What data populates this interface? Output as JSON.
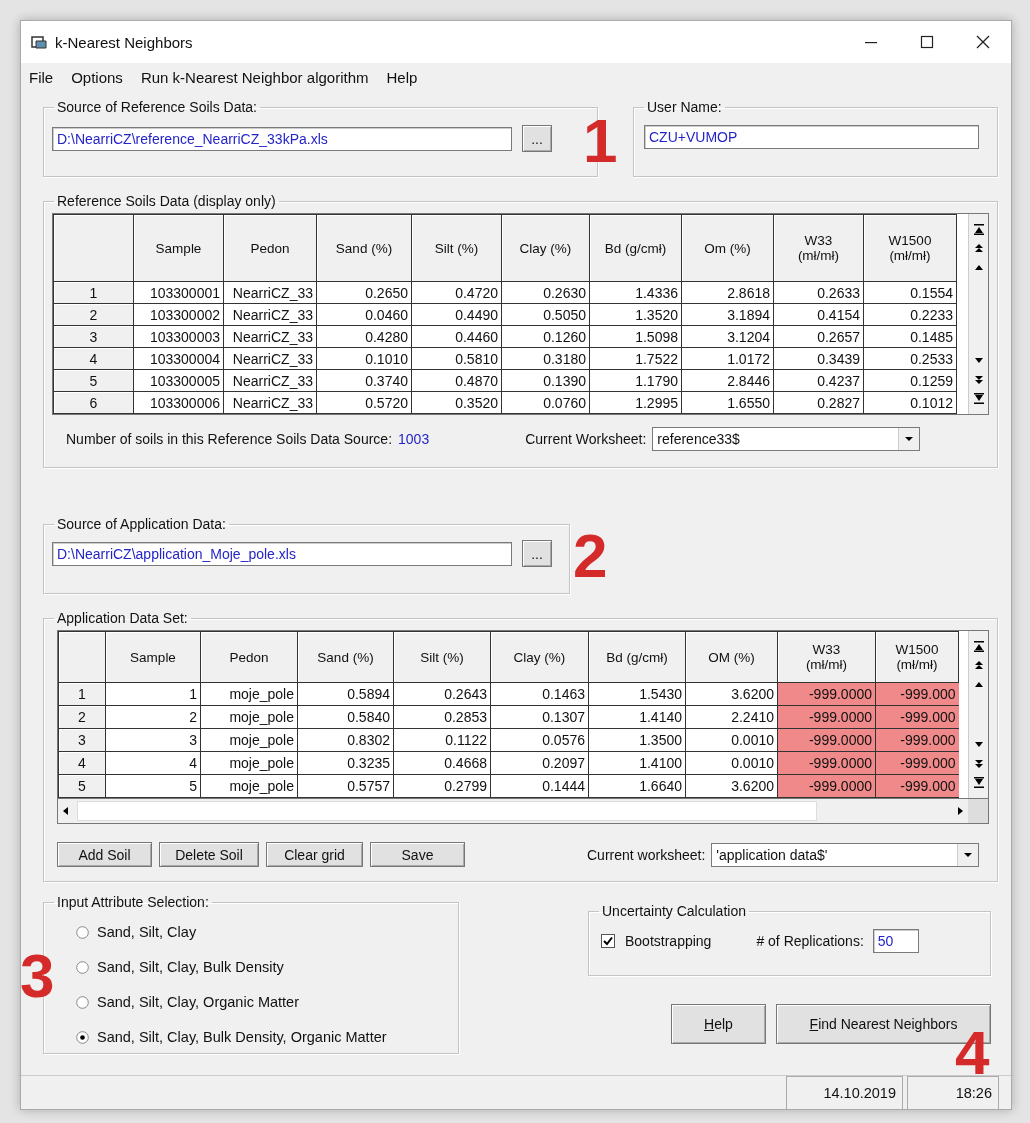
{
  "window": {
    "title": "k-Nearest Neighbors"
  },
  "menu": [
    "File",
    "Options",
    "Run k-Nearest Neighbor algorithm",
    "Help"
  ],
  "reference_source": {
    "label": "Source of Reference Soils Data:",
    "value": "D:\\NearriCZ\\reference_NearriCZ_33kPa.xls",
    "browse": "..."
  },
  "user_name": {
    "label": "User Name:",
    "value": "CZU+VUMOP"
  },
  "reference_grid": {
    "label": "Reference Soils Data (display only)",
    "columns": [
      {
        "label": "Sample",
        "highlighted": false
      },
      {
        "label": "Pedon",
        "highlighted": false
      },
      {
        "label": "Sand (%)",
        "highlighted": false
      },
      {
        "label": "Silt (%)",
        "highlighted": false
      },
      {
        "label": "Clay (%)",
        "highlighted": false
      },
      {
        "label": "Bd (g/cmł)",
        "highlighted": false
      },
      {
        "label": "Om (%)",
        "highlighted": false
      },
      {
        "label": "W33\n(mł/mł)",
        "highlighted": false
      },
      {
        "label": "W1500\n(mł/mł)",
        "highlighted": false
      }
    ],
    "rows": [
      {
        "header": "1",
        "cells": [
          "103300001",
          "NearriCZ_33",
          "0.2650",
          "0.4720",
          "0.2630",
          "1.4336",
          "2.8618",
          "0.2633",
          "0.1554"
        ]
      },
      {
        "header": "2",
        "cells": [
          "103300002",
          "NearriCZ_33",
          "0.0460",
          "0.4490",
          "0.5050",
          "1.3520",
          "3.1894",
          "0.4154",
          "0.2233"
        ]
      },
      {
        "header": "3",
        "cells": [
          "103300003",
          "NearriCZ_33",
          "0.4280",
          "0.4460",
          "0.1260",
          "1.5098",
          "3.1204",
          "0.2657",
          "0.1485"
        ]
      },
      {
        "header": "4",
        "cells": [
          "103300004",
          "NearriCZ_33",
          "0.1010",
          "0.5810",
          "0.3180",
          "1.7522",
          "1.0172",
          "0.3439",
          "0.2533"
        ]
      },
      {
        "header": "5",
        "cells": [
          "103300005",
          "NearriCZ_33",
          "0.3740",
          "0.4870",
          "0.1390",
          "1.1790",
          "2.8446",
          "0.4237",
          "0.1259"
        ]
      },
      {
        "header": "6",
        "cells": [
          "103300006",
          "NearriCZ_33",
          "0.5720",
          "0.3520",
          "0.0760",
          "1.2995",
          "1.6550",
          "0.2827",
          "0.1012"
        ]
      }
    ]
  },
  "reference_count": {
    "label": "Number of soils in this Reference Soils Data Source:",
    "value": "1003"
  },
  "reference_worksheet": {
    "label": "Current Worksheet:",
    "value": "reference33$"
  },
  "application_source": {
    "label": "Source of Application Data:",
    "value": "D:\\NearriCZ\\application_Moje_pole.xls",
    "browse": "..."
  },
  "application_grid": {
    "label": "Application Data Set:",
    "columns": [
      {
        "label": "Sample",
        "highlighted": false
      },
      {
        "label": "Pedon",
        "highlighted": false
      },
      {
        "label": "Sand (%)",
        "highlighted": false
      },
      {
        "label": "Silt (%)",
        "highlighted": false
      },
      {
        "label": "Clay (%)",
        "highlighted": false
      },
      {
        "label": "Bd (g/cmł)",
        "highlighted": false
      },
      {
        "label": "OM (%)",
        "highlighted": false
      },
      {
        "label": "W33\n(mł/mł)",
        "highlighted": true
      },
      {
        "label": "W1500\n(mł/mł)",
        "highlighted": true
      }
    ],
    "rows": [
      {
        "header": "1",
        "cells": [
          "1",
          "moje_pole",
          "0.5894",
          "0.2643",
          "0.1463",
          "1.5430",
          "3.6200",
          "-999.0000",
          "-999.000"
        ]
      },
      {
        "header": "2",
        "cells": [
          "2",
          "moje_pole",
          "0.5840",
          "0.2853",
          "0.1307",
          "1.4140",
          "2.2410",
          "-999.0000",
          "-999.000"
        ]
      },
      {
        "header": "3",
        "cells": [
          "3",
          "moje_pole",
          "0.8302",
          "0.1122",
          "0.0576",
          "1.3500",
          "0.0010",
          "-999.0000",
          "-999.000"
        ]
      },
      {
        "header": "4",
        "cells": [
          "4",
          "moje_pole",
          "0.3235",
          "0.4668",
          "0.2097",
          "1.4100",
          "0.0010",
          "-999.0000",
          "-999.000"
        ]
      },
      {
        "header": "5",
        "cells": [
          "5",
          "moje_pole",
          "0.5757",
          "0.2799",
          "0.1444",
          "1.6640",
          "3.6200",
          "-999.0000",
          "-999.000"
        ]
      }
    ]
  },
  "application_buttons": [
    "Add Soil",
    "Delete Soil",
    "Clear grid",
    "Save"
  ],
  "application_worksheet": {
    "label": "Current worksheet:",
    "value": "'application data$'"
  },
  "input_attributes": {
    "label": "Input Attribute Selection:",
    "options": [
      {
        "label": "Sand, Silt, Clay",
        "selected": false
      },
      {
        "label": "Sand, Silt, Clay, Bulk Density",
        "selected": false
      },
      {
        "label": "Sand, Silt, Clay, Organic Matter",
        "selected": false
      },
      {
        "label": "Sand, Silt, Clay, Bulk Density, Organic Matter",
        "selected": true
      }
    ]
  },
  "uncertainty": {
    "label": "Uncertainty Calculation",
    "bootstrapping": {
      "label": "Bootstrapping",
      "checked": true
    },
    "replications": {
      "label": "# of Replications:",
      "value": "50"
    }
  },
  "buttons": [
    {
      "label": "Help",
      "underline_first": true
    },
    {
      "label": "Find Nearest Neighbors",
      "underline_first": true
    }
  ],
  "status_bar": {
    "date": "14.10.2019",
    "time": "18:26"
  },
  "annotations": [
    "1",
    "2",
    "3",
    "4"
  ]
}
